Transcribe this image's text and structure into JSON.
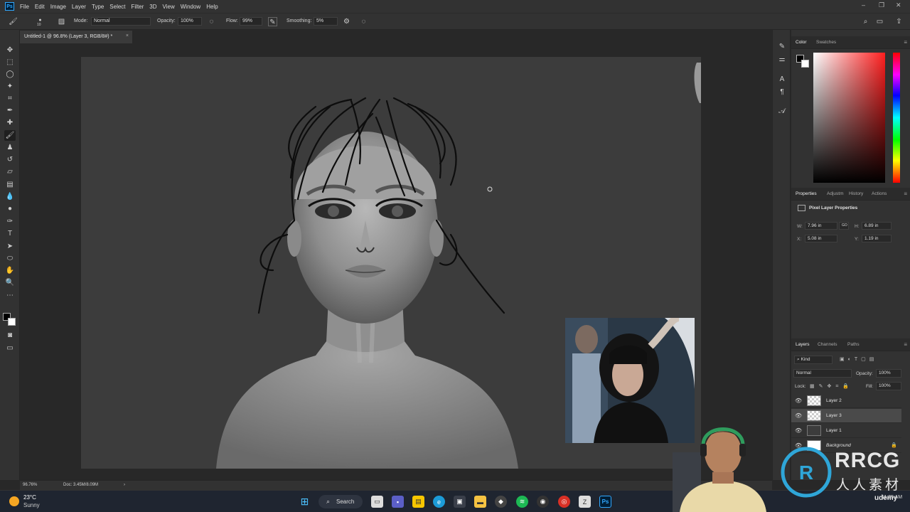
{
  "app": {
    "logo": "Ps",
    "menu": [
      "File",
      "Edit",
      "Image",
      "Layer",
      "Type",
      "Select",
      "Filter",
      "3D",
      "View",
      "Window",
      "Help"
    ]
  },
  "options": {
    "brush_size": "10",
    "mode_label": "Mode:",
    "mode_value": "Normal",
    "opacity_label": "Opacity:",
    "opacity_value": "100%",
    "flow_label": "Flow:",
    "flow_value": "99%",
    "smoothing_label": "Smoothing:",
    "smoothing_value": "5%"
  },
  "document": {
    "tab_title": "Untitled-1 @ 96.8% (Layer 3, RGB/8#) *",
    "close_glyph": "×"
  },
  "status": {
    "zoom": "96.76%",
    "doc_size": "Doc: 3.45M/8.09M",
    "arrow": "›"
  },
  "color_panel": {
    "tabs": [
      "Color",
      "Swatches"
    ],
    "fg_color": "#000000",
    "bg_color": "#ffffff"
  },
  "properties": {
    "tabs": [
      "Properties",
      "Adjustm",
      "History",
      "Actions"
    ],
    "title": "Pixel Layer Properties",
    "w_label": "W:",
    "w_value": "7.96 in",
    "h_label": "H:",
    "h_value": "6.89 in",
    "x_label": "X:",
    "x_value": "5.08 in",
    "y_label": "Y:",
    "y_value": "1.19 in",
    "link_glyph": "GO"
  },
  "layers_panel": {
    "tabs": [
      "Layers",
      "Channels",
      "Paths"
    ],
    "filter_label": "Kind",
    "blend_mode": "Normal",
    "opacity_label": "Opacity:",
    "opacity_value": "100%",
    "lock_label": "Lock:",
    "fill_label": "Fill:",
    "fill_value": "100%",
    "layers": [
      {
        "name": "Layer 2",
        "selected": false
      },
      {
        "name": "Layer 3",
        "selected": true
      },
      {
        "name": "Layer 1",
        "selected": false
      },
      {
        "name": "Background",
        "selected": false
      }
    ]
  },
  "taskbar": {
    "weather_temp": "23°C",
    "weather_desc": "Sunny",
    "search_label": "Search",
    "time": "11:25 AM"
  },
  "overlay": {
    "watermark_title": "RRCG",
    "watermark_sub": "人人素材",
    "udemy": "udemy"
  },
  "colors": {
    "ui_dark": "#323232",
    "canvas_bg": "#3c3c3c",
    "ps_blue": "#31a8ff"
  }
}
